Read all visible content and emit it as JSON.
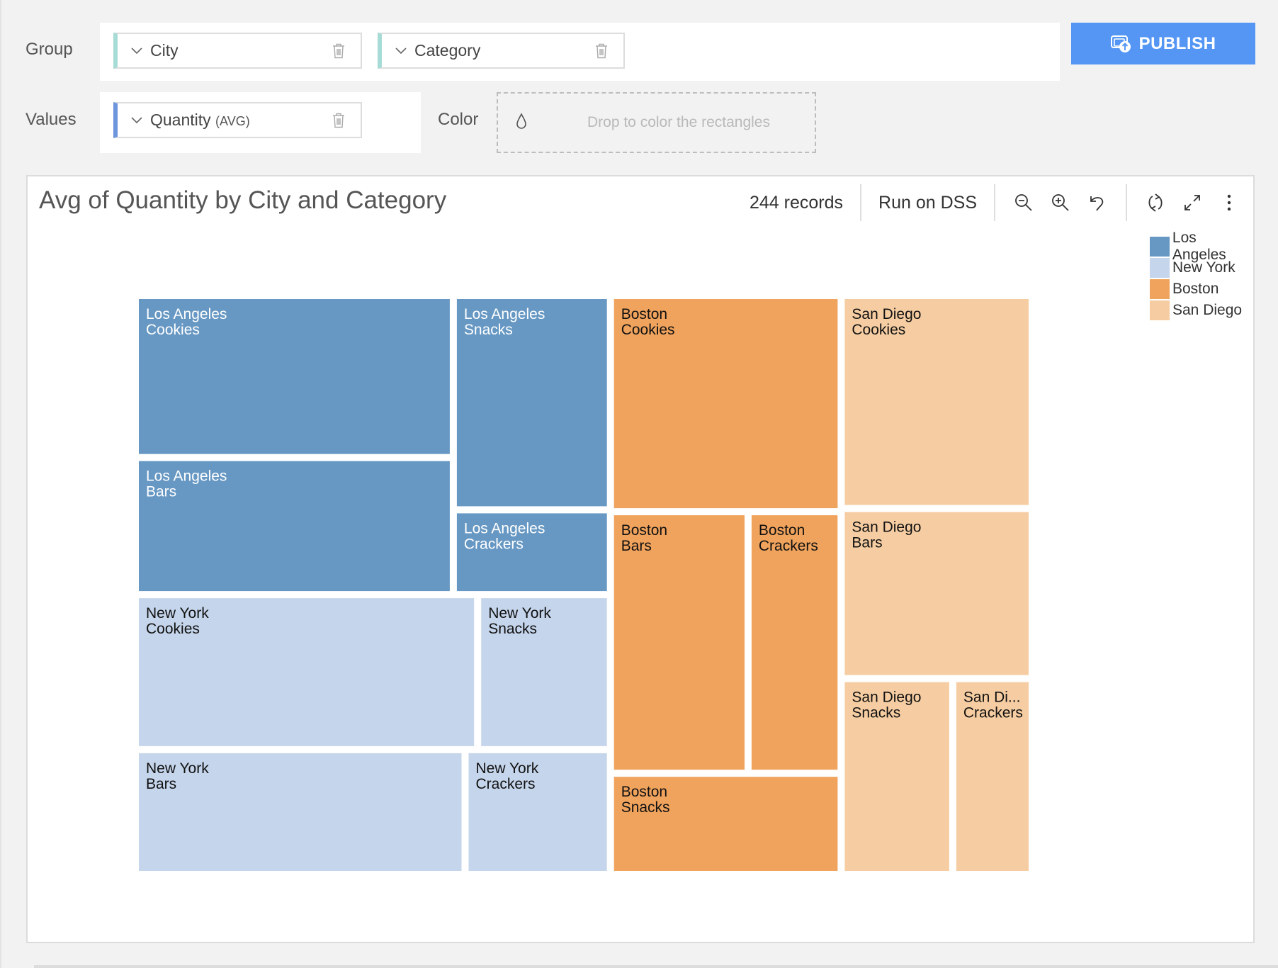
{
  "builder": {
    "group_label": "Group",
    "values_label": "Values",
    "color_label": "Color",
    "group_fields": [
      {
        "name": "City",
        "icon": "chevron-down-icon",
        "remove_icon": "trash-icon"
      },
      {
        "name": "Category",
        "icon": "chevron-down-icon",
        "remove_icon": "trash-icon"
      }
    ],
    "value_field": {
      "name": "Quantity",
      "aggregation": "(AVG)",
      "icon": "chevron-down-icon",
      "remove_icon": "trash-icon"
    },
    "color_drop_hint": "Drop to color the rectangles",
    "color_drop_icon": "droplet-icon",
    "publish_label": "PUBLISH",
    "publish_icon": "publish-icon",
    "accent_color": "#5596f5"
  },
  "toolbar": {
    "records": "244 records",
    "run_on": "Run on DSS",
    "icons": [
      "zoom-out-icon",
      "zoom-in-icon",
      "undo-icon",
      "refresh-icon",
      "expand-icon",
      "more-vertical-icon"
    ]
  },
  "chart_data": {
    "type": "treemap",
    "title": "Avg of Quantity by City and Category",
    "group_by": [
      "City",
      "Category"
    ],
    "measure": "Quantity (AVG)",
    "legend": {
      "position": "top-right",
      "items": [
        {
          "label": "Los Angeles",
          "color": "#6798c3"
        },
        {
          "label": "New York",
          "color": "#c5d5eb"
        },
        {
          "label": "Boston",
          "color": "#f0a35d"
        },
        {
          "label": "San Diego",
          "color": "#f6cda2"
        }
      ]
    },
    "groups": [
      {
        "city": "Los Angeles",
        "color": "#6798c3",
        "label_color": "#ffffff",
        "layout": "la",
        "children": [
          {
            "category": "Cookies",
            "label": [
              "Los Angeles",
              "Cookies"
            ],
            "value": 6.2
          },
          {
            "category": "Bars",
            "label": [
              "Los Angeles",
              "Bars"
            ],
            "value": 5.2
          },
          {
            "category": "Snacks",
            "label": [
              "Los Angeles",
              "Snacks"
            ],
            "value": 4.0
          },
          {
            "category": "Crackers",
            "label": [
              "Los Angeles",
              "Crackers"
            ],
            "value": 1.5
          }
        ]
      },
      {
        "city": "New York",
        "color": "#c5d5eb",
        "label_color": "#111111",
        "layout": "ny",
        "children": [
          {
            "category": "Cookies",
            "label": [
              "New York",
              "Cookies"
            ],
            "value": 6.4
          },
          {
            "category": "Bars",
            "label": [
              "New York",
              "Bars"
            ],
            "value": 4.9
          },
          {
            "category": "Snacks",
            "label": [
              "New York",
              "Snacks"
            ],
            "value": 2.4
          },
          {
            "category": "Crackers",
            "label": [
              "New York",
              "Crackers"
            ],
            "value": 2.1
          }
        ]
      },
      {
        "city": "Boston",
        "color": "#f0a35d",
        "label_color": "#111111",
        "layout": "bo",
        "children": [
          {
            "category": "Cookies",
            "label": [
              "Boston",
              "Cookies"
            ],
            "value": 6.0
          },
          {
            "category": "Bars",
            "label": [
              "Boston",
              "Bars"
            ],
            "value": 4.4
          },
          {
            "category": "Crackers",
            "label": [
              "Boston",
              "Crackers"
            ],
            "value": 2.9
          },
          {
            "category": "Snacks",
            "label": [
              "Boston",
              "Snacks"
            ],
            "value": 2.7
          }
        ]
      },
      {
        "city": "San Diego",
        "color": "#f6cda2",
        "label_color": "#111111",
        "layout": "sd",
        "children": [
          {
            "category": "Cookies",
            "label": [
              "San Diego",
              "Cookies"
            ],
            "value": 4.8
          },
          {
            "category": "Bars",
            "label": [
              "San Diego",
              "Bars"
            ],
            "value": 3.8
          },
          {
            "category": "Snacks",
            "label": [
              "San Diego",
              "Snacks"
            ],
            "value": 2.6
          },
          {
            "category": "Crackers",
            "label": [
              "San Di...",
              "Crackers"
            ],
            "value": 1.8
          }
        ]
      }
    ]
  }
}
